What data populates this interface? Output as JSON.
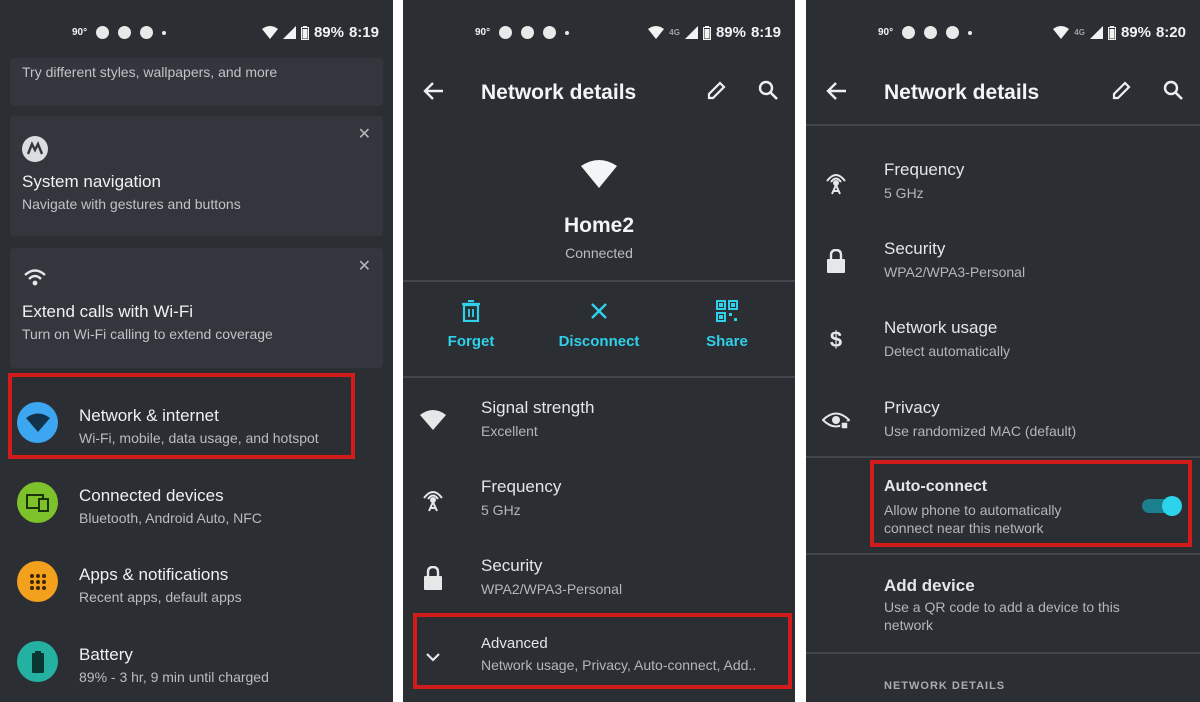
{
  "colors": {
    "background": "#2b2e33",
    "card": "#33363c",
    "accent": "#2fd0ea",
    "highlight": "#d21c1c",
    "network_icon_bg": "#3da6f0",
    "devices_icon_bg": "#7dc12b",
    "apps_icon_bg": "#f3a01d",
    "battery_icon_bg": "#24b1a1"
  },
  "panel1": {
    "status": {
      "temp": "90°",
      "battery": "89%",
      "time": "8:19"
    },
    "top_card_sub": "Try different styles, wallpapers, and more",
    "cards": [
      {
        "title": "System navigation",
        "sub": "Navigate with gestures and buttons",
        "icon": "motorola-logo-icon"
      },
      {
        "title": "Extend calls with Wi-Fi",
        "sub": "Turn on Wi-Fi calling to extend coverage",
        "icon": "wifi-icon"
      }
    ],
    "menu": [
      {
        "title": "Network & internet",
        "sub": "Wi-Fi, mobile, data usage, and hotspot",
        "icon": "wifi-icon"
      },
      {
        "title": "Connected devices",
        "sub": "Bluetooth, Android Auto, NFC",
        "icon": "devices-icon"
      },
      {
        "title": "Apps & notifications",
        "sub": "Recent apps, default apps",
        "icon": "apps-grid-icon"
      },
      {
        "title": "Battery",
        "sub": "89% - 3 hr, 9 min until charged",
        "icon": "battery-icon"
      }
    ]
  },
  "panel2": {
    "status": {
      "temp": "90°",
      "network": "4G",
      "battery": "89%",
      "time": "8:19"
    },
    "title": "Network details",
    "network_name": "Home2",
    "network_status": "Connected",
    "actions": [
      {
        "label": "Forget",
        "icon": "trash-icon"
      },
      {
        "label": "Disconnect",
        "icon": "close-icon"
      },
      {
        "label": "Share",
        "icon": "qr-code-icon"
      }
    ],
    "rows": [
      {
        "title": "Signal strength",
        "sub": "Excellent",
        "icon": "wifi-icon"
      },
      {
        "title": "Frequency",
        "sub": "5 GHz",
        "icon": "antenna-icon"
      },
      {
        "title": "Security",
        "sub": "WPA2/WPA3-Personal",
        "icon": "lock-icon"
      },
      {
        "title": "Advanced",
        "sub": "Network usage, Privacy, Auto-connect, Add..",
        "icon": "chevron-down-icon"
      }
    ]
  },
  "panel3": {
    "status": {
      "temp": "90°",
      "network": "4G",
      "battery": "89%",
      "time": "8:20"
    },
    "title": "Network details",
    "rows": [
      {
        "title": "Frequency",
        "sub": "5 GHz",
        "icon": "antenna-icon"
      },
      {
        "title": "Security",
        "sub": "WPA2/WPA3-Personal",
        "icon": "lock-icon"
      },
      {
        "title": "Network usage",
        "sub": "Detect automatically",
        "icon": "dollar-icon"
      },
      {
        "title": "Privacy",
        "sub": "Use randomized MAC (default)",
        "icon": "eye-icon"
      }
    ],
    "auto_connect": {
      "title": "Auto-connect",
      "sub_line1": "Allow phone to automatically",
      "sub_line2": "connect near this network",
      "enabled": true
    },
    "add_device": {
      "title": "Add device",
      "sub_line1": "Use a QR code to add a device to this",
      "sub_line2": "network"
    },
    "section_label": "NETWORK DETAILS"
  }
}
